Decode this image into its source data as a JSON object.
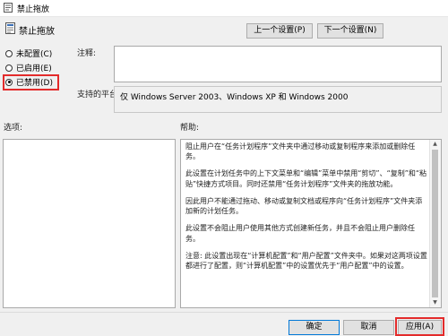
{
  "window": {
    "title": "禁止拖放"
  },
  "header": {
    "title": "禁止拖放"
  },
  "nav": {
    "prev_label": "上一个设置(P)",
    "next_label": "下一个设置(N)"
  },
  "state": {
    "options": [
      {
        "label": "未配置(C)",
        "selected": false
      },
      {
        "label": "已启用(E)",
        "selected": false
      },
      {
        "label": "已禁用(D)",
        "selected": true
      }
    ]
  },
  "comment": {
    "label": "注释:",
    "value": ""
  },
  "supported": {
    "label": "支持的平台:",
    "value": "仅 Windows Server 2003、Windows XP 和 Windows 2000"
  },
  "options_section": {
    "label": "选项:"
  },
  "help_section": {
    "label": "帮助:",
    "paragraphs": [
      "阻止用户在“任务计划程序”文件夹中通过移动或复制程序来添加或删除任务。",
      "此设置在计划任务中的上下文菜单和“编辑”菜单中禁用“剪切”、“复制”和“粘贴”快捷方式项目。同时还禁用“任务计划程序”文件夹的拖放功能。",
      "因此用户不能通过拖动、移动或复制文档或程序向“任务计划程序”文件夹添加新的计划任务。",
      "此设置不会阻止用户使用其他方式创建新任务，并且不会阻止用户删除任务。",
      "注意: 此设置出现在“计算机配置”和“用户配置”文件夹中。如果对这两项设置都进行了配置，则“计算机配置”中的设置优先于“用户配置”中的设置。"
    ]
  },
  "footer": {
    "ok_label": "确定",
    "cancel_label": "取消",
    "apply_label": "应用(A)"
  },
  "colors": {
    "highlight": "#e32b2b",
    "window_bg": "#f0f0f0"
  }
}
